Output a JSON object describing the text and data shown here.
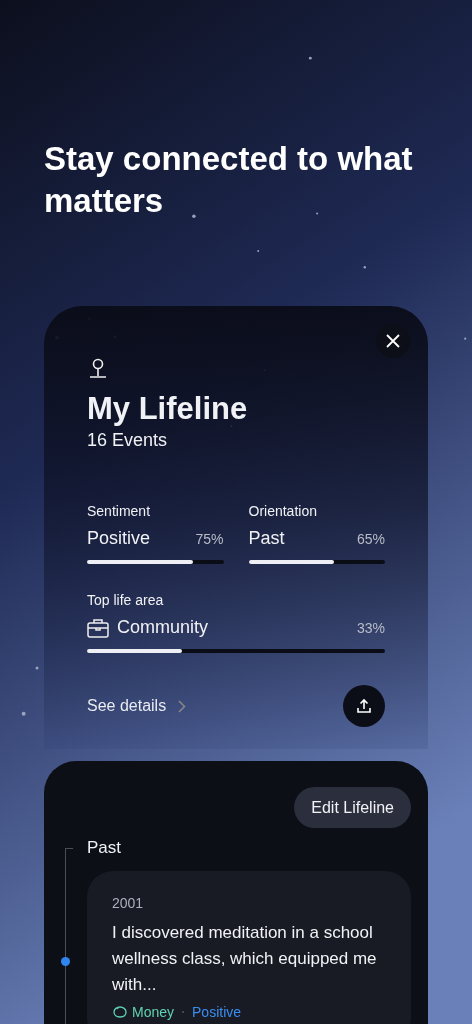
{
  "heading": "Stay connected to what matters",
  "summary": {
    "title": "My Lifeline",
    "subtitle": "16 Events",
    "stats": [
      {
        "label": "Sentiment",
        "value": "Positive",
        "reading": "75%",
        "level": 0.78
      },
      {
        "label": "Orientation",
        "value": "Past",
        "reading": "65%",
        "level": 0.63
      }
    ],
    "top_area": {
      "label": "Top life area",
      "value": "Community",
      "reading": "33%",
      "level": 0.32
    },
    "details_link": "See details"
  },
  "timeline": {
    "edit_button": "Edit Lifeline",
    "sections": [
      {
        "title": "Past",
        "events": [
          {
            "year": "2001",
            "text": "I discovered meditation in a school wellness class, which equipped me with...",
            "tags": [
              {
                "kind": "area",
                "label": "Money",
                "color": "#5fd3b3"
              },
              {
                "kind": "sentiment",
                "label": "Positive",
                "color": "#3a8ef0"
              }
            ]
          }
        ]
      }
    ]
  }
}
